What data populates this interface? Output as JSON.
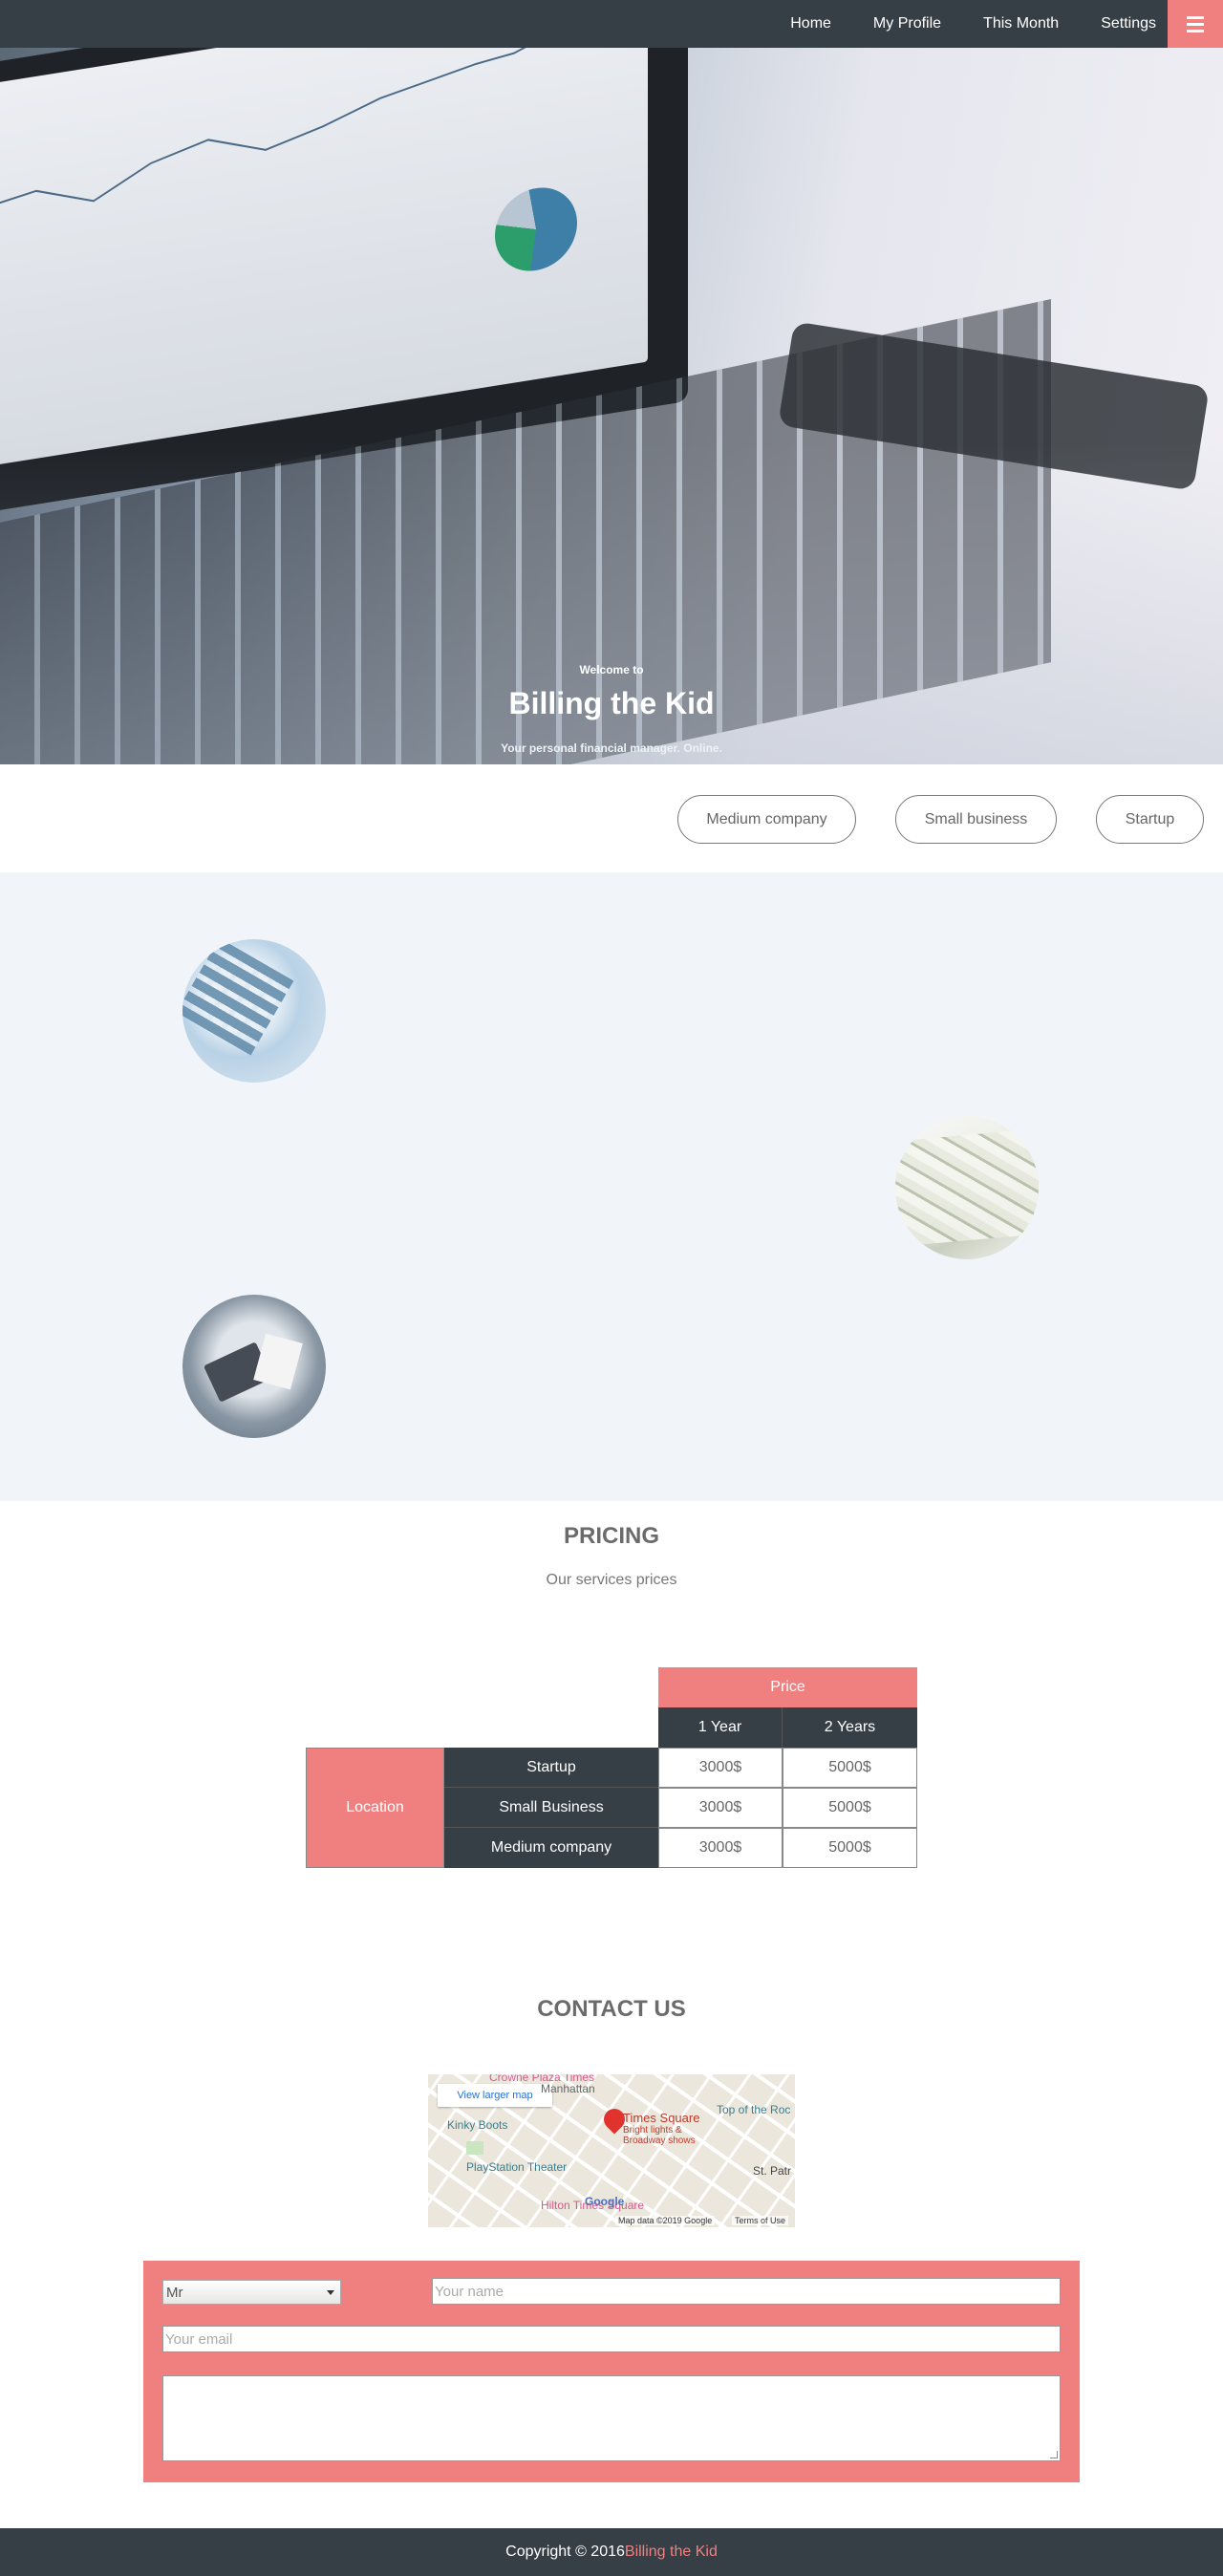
{
  "nav": {
    "items": [
      {
        "label": "Home"
      },
      {
        "label": "My Profile"
      },
      {
        "label": "This Month"
      },
      {
        "label": "Settings"
      }
    ],
    "menu_icon": "hamburger-icon"
  },
  "hero": {
    "welcome": "Welcome to",
    "title": "Billing the Kid",
    "subtitle": "Your personal financial manager. Online."
  },
  "filters": [
    "Medium company",
    "Small business",
    "Startup"
  ],
  "pricing": {
    "title": "PRICING",
    "subtitle": "Our services prices",
    "price_header": "Price",
    "periods": [
      "1 Year",
      "2 Years"
    ],
    "row_group": "Location",
    "rows": [
      {
        "name": "Startup",
        "one_year": "3000$",
        "two_years": "5000$"
      },
      {
        "name": "Small Business",
        "one_year": "3000$",
        "two_years": "5000$"
      },
      {
        "name": "Medium company",
        "one_year": "3000$",
        "two_years": "5000$"
      }
    ]
  },
  "contact": {
    "title": "CONTACT US",
    "map": {
      "view_larger": "View larger map",
      "place": "Times Square",
      "place_desc_1": "Bright lights &",
      "place_desc_2": "Broadway shows",
      "labels": [
        "Crowne Plaza Times",
        "Manhattan",
        "Kinky Boots",
        "Top of the Roc",
        "PlayStation Theater",
        "St. Patr",
        "Hilton Times Square",
        "Google"
      ],
      "data": "Map data ©2019 Google",
      "terms": "Terms of Use"
    },
    "form": {
      "title_select": "Mr",
      "name_placeholder": "Your name",
      "email_placeholder": "Your email"
    }
  },
  "footer": {
    "copyright": "Copyright © 2016",
    "brand": "Billing the Kid"
  },
  "colors": {
    "accent": "#f08080",
    "dark": "#363f46",
    "band": "#f1f5f9"
  }
}
